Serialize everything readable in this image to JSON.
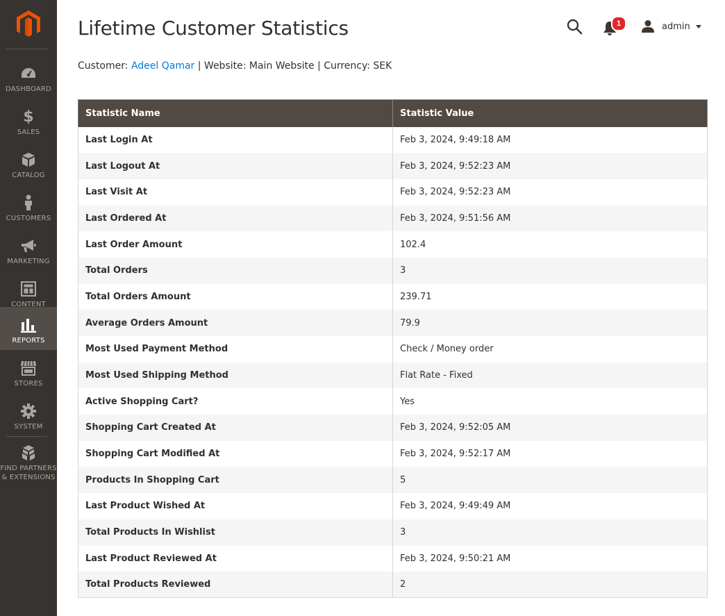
{
  "sidebar": {
    "items": [
      {
        "label": "DASHBOARD",
        "icon": "dashboard-icon"
      },
      {
        "label": "SALES",
        "icon": "dollar-icon"
      },
      {
        "label": "CATALOG",
        "icon": "box-icon"
      },
      {
        "label": "CUSTOMERS",
        "icon": "person-icon"
      },
      {
        "label": "MARKETING",
        "icon": "megaphone-icon"
      },
      {
        "label": "CONTENT",
        "icon": "layout-icon"
      },
      {
        "label": "REPORTS",
        "icon": "bar-chart-icon",
        "active": true
      },
      {
        "label": "STORES",
        "icon": "storefront-icon"
      },
      {
        "label": "SYSTEM",
        "icon": "gear-icon"
      },
      {
        "label": "FIND PARTNERS\n& EXTENSIONS",
        "icon": "cubes-icon"
      }
    ]
  },
  "header": {
    "title": "Lifetime Customer Statistics",
    "notification_count": "1",
    "admin_name": "admin"
  },
  "info": {
    "customer_label": "Customer:",
    "customer_name": "Adeel Qamar",
    "website_text": "| Website: Main Website",
    "currency_text": "| Currency: SEK"
  },
  "table": {
    "headers": [
      "Statistic Name",
      "Statistic Value"
    ],
    "rows": [
      {
        "name": "Last Login At",
        "value": "Feb 3, 2024, 9:49:18 AM"
      },
      {
        "name": "Last Logout At",
        "value": "Feb 3, 2024, 9:52:23 AM"
      },
      {
        "name": "Last Visit At",
        "value": "Feb 3, 2024, 9:52:23 AM"
      },
      {
        "name": "Last Ordered At",
        "value": "Feb 3, 2024, 9:51:56 AM"
      },
      {
        "name": "Last Order Amount",
        "value": "102.4"
      },
      {
        "name": "Total Orders",
        "value": "3"
      },
      {
        "name": "Total Orders Amount",
        "value": "239.71"
      },
      {
        "name": "Average Orders Amount",
        "value": "79.9"
      },
      {
        "name": "Most Used Payment Method",
        "value": "Check / Money order"
      },
      {
        "name": "Most Used Shipping Method",
        "value": "Flat Rate - Fixed"
      },
      {
        "name": "Active Shopping Cart?",
        "value": "Yes"
      },
      {
        "name": "Shopping Cart Created At",
        "value": "Feb 3, 2024, 9:52:05 AM"
      },
      {
        "name": "Shopping Cart Modified At",
        "value": "Feb 3, 2024, 9:52:17 AM"
      },
      {
        "name": "Products In Shopping Cart",
        "value": "5"
      },
      {
        "name": "Last Product Wished At",
        "value": "Feb 3, 2024, 9:49:49 AM"
      },
      {
        "name": "Total Products In Wishlist",
        "value": "3"
      },
      {
        "name": "Last Product Reviewed At",
        "value": "Feb 3, 2024, 9:50:21 AM"
      },
      {
        "name": "Total Products Reviewed",
        "value": "2"
      }
    ]
  },
  "colors": {
    "sidebar_bg": "#373330",
    "sidebar_active": "#524d49",
    "brand_orange": "#eb5202",
    "link_blue": "#007bdb",
    "table_header_bg": "#514943",
    "badge_red": "#e22626"
  }
}
